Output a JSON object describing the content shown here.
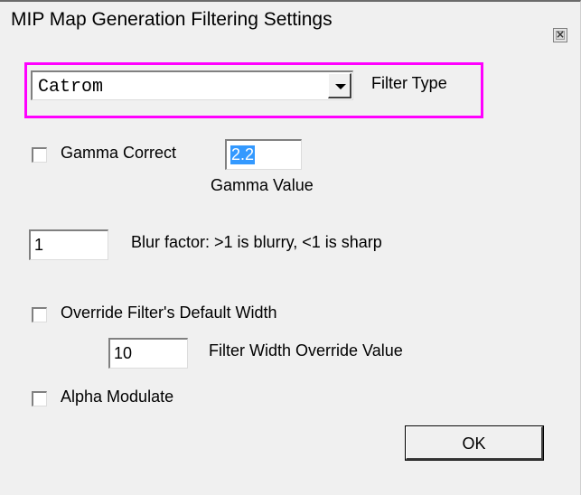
{
  "window": {
    "title": "MIP Map Generation Filtering Settings",
    "close_symbol": "×"
  },
  "filter": {
    "selected": "Catrom",
    "label": "Filter Type"
  },
  "gamma": {
    "checkbox_label": "Gamma Correct",
    "checked": false,
    "value": "2.2",
    "value_label": "Gamma Value"
  },
  "blur": {
    "value": "1",
    "label": "Blur factor: >1 is blurry, <1 is sharp"
  },
  "filter_width": {
    "checkbox_label": "Override Filter's Default Width",
    "checked": false,
    "value": "10",
    "value_label": "Filter Width Override Value"
  },
  "alpha": {
    "checkbox_label": "Alpha Modulate",
    "checked": false
  },
  "buttons": {
    "ok": "OK"
  },
  "colors": {
    "highlight_border": "#ff00ff",
    "selection": "#3399ff",
    "dialog_bg": "#f0f0f0"
  }
}
